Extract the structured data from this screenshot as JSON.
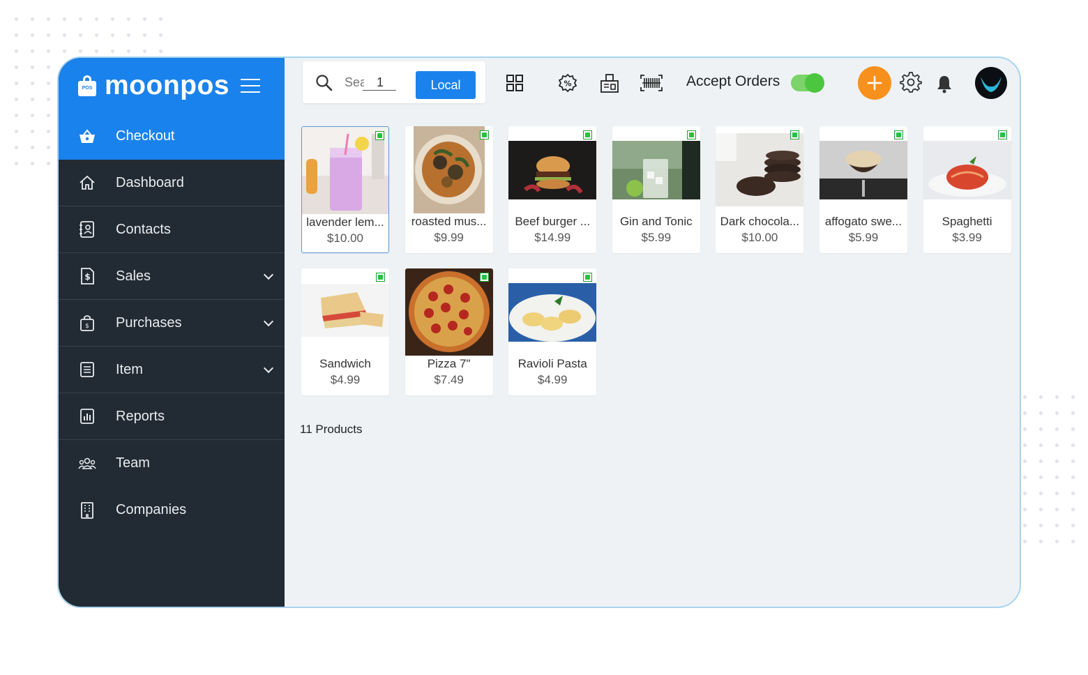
{
  "app": {
    "name": "moonpos",
    "logo_tag": "POS"
  },
  "sidebar": {
    "items": [
      {
        "label": "Checkout",
        "icon": "basket-icon",
        "active": true,
        "expandable": false
      },
      {
        "label": "Dashboard",
        "icon": "home-icon",
        "active": false,
        "expandable": false
      },
      {
        "label": "Contacts",
        "icon": "address-book-icon",
        "active": false,
        "expandable": false
      },
      {
        "label": "Sales",
        "icon": "dollar-doc-icon",
        "active": false,
        "expandable": true
      },
      {
        "label": "Purchases",
        "icon": "shopping-bag-icon",
        "active": false,
        "expandable": true
      },
      {
        "label": "Item",
        "icon": "list-icon",
        "active": false,
        "expandable": true
      },
      {
        "label": "Reports",
        "icon": "bar-chart-icon",
        "active": false,
        "expandable": false
      },
      {
        "label": "Team",
        "icon": "team-icon",
        "active": false,
        "expandable": false
      },
      {
        "label": "Companies",
        "icon": "building-icon",
        "active": false,
        "expandable": false
      }
    ]
  },
  "toolbar": {
    "search_placeholder": "Search",
    "quantity_value": "1",
    "local_label": "Local",
    "accept_orders_label": "Accept Orders",
    "accept_orders_on": true
  },
  "products": [
    {
      "name": "lavender lem...",
      "price": "$10.00",
      "selected": true
    },
    {
      "name": "roasted mus...",
      "price": "$9.99",
      "selected": false
    },
    {
      "name": "Beef burger ...",
      "price": "$14.99",
      "selected": false
    },
    {
      "name": "Gin and Tonic",
      "price": "$5.99",
      "selected": false
    },
    {
      "name": "Dark chocola...",
      "price": "$10.00",
      "selected": false
    },
    {
      "name": "affogato swe...",
      "price": "$5.99",
      "selected": false
    },
    {
      "name": "Spaghetti",
      "price": "$3.99",
      "selected": false
    },
    {
      "name": "Sandwich",
      "price": "$4.99",
      "selected": false
    },
    {
      "name": "Pizza 7\"",
      "price": "$7.49",
      "selected": false
    },
    {
      "name": "Ravioli Pasta",
      "price": "$4.99",
      "selected": false
    }
  ],
  "product_count": "11 Products",
  "colors": {
    "accent": "#1a82ec",
    "sidebar": "#222a33",
    "add_button": "#f8901e",
    "toggle_on": "#4cc63f",
    "badge": "#27c23d"
  }
}
